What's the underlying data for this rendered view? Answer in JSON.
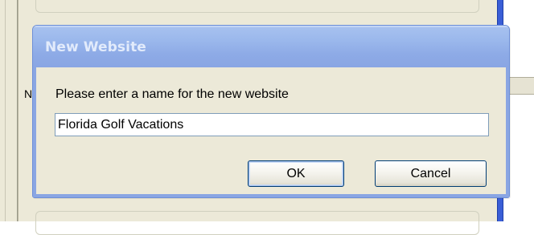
{
  "background": {
    "left_label_fragment": "N"
  },
  "dialog": {
    "title": "New Website",
    "prompt": "Please enter a name for the new website",
    "name_field": {
      "value": "Florida Golf Vacations",
      "placeholder": ""
    },
    "buttons": {
      "ok_label": "OK",
      "cancel_label": "Cancel"
    }
  },
  "colors": {
    "titlebar": "#9bb8ec",
    "title_text": "#e2ebfb",
    "dialog_face": "#ece9d8",
    "input_border": "#7f9db9",
    "button_border": "#003c74"
  }
}
